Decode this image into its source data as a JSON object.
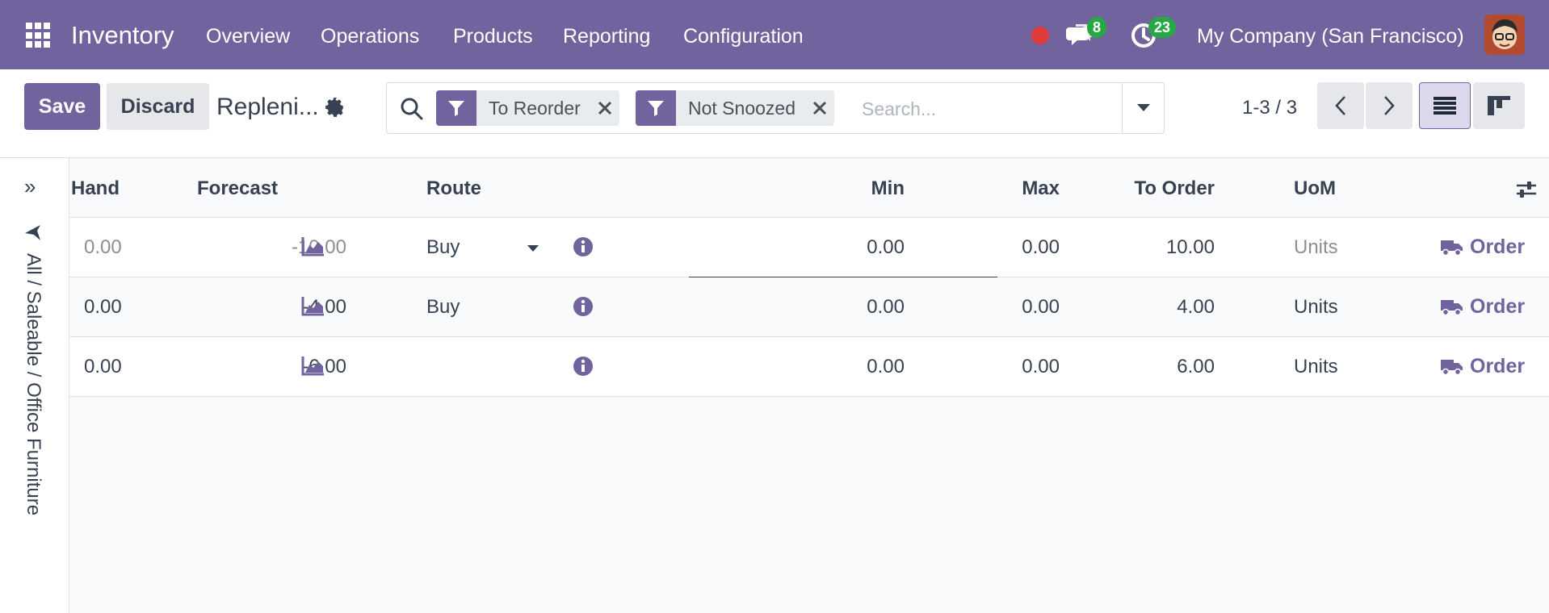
{
  "nav": {
    "brand": "Inventory",
    "menu": [
      "Overview",
      "Operations",
      "Products",
      "Reporting",
      "Configuration"
    ],
    "messages_count": "8",
    "activities_count": "23",
    "company": "My Company (San Francisco)"
  },
  "control": {
    "save_label": "Save",
    "discard_label": "Discard",
    "title": "Repleni...",
    "facets": [
      "To Reorder",
      "Not Snoozed"
    ],
    "search_placeholder": "Search...",
    "pager": "1-3 / 3"
  },
  "side_panel": {
    "expand_glyph": "»",
    "path": "All / Saleable / Office Furniture"
  },
  "table": {
    "headers": {
      "on_hand": "Hand",
      "forecast": "Forecast",
      "route": "Route",
      "min": "Min",
      "max": "Max",
      "to_order": "To Order",
      "uom": "UoM"
    },
    "rows": [
      {
        "on_hand": "0.00",
        "forecast": "-10.00",
        "route": "Buy",
        "min": "0.00",
        "max": "0.00",
        "to_order": "10.00",
        "uom": "Units",
        "action": "Order"
      },
      {
        "on_hand": "0.00",
        "forecast": "-4.00",
        "route": "Buy",
        "min": "0.00",
        "max": "0.00",
        "to_order": "4.00",
        "uom": "Units",
        "action": "Order"
      },
      {
        "on_hand": "0.00",
        "forecast": "-6.00",
        "route": "",
        "min": "0.00",
        "max": "0.00",
        "to_order": "6.00",
        "uom": "Units",
        "action": "Order"
      }
    ]
  },
  "colors": {
    "brand": "#71639e",
    "badge": "#28a745",
    "status_dot": "#e03a3a"
  },
  "icons": [
    "apps-grid-icon",
    "chat-icon",
    "clock-icon",
    "gear-icon",
    "search-icon",
    "filter-icon",
    "close-icon",
    "caret-down-icon",
    "chevron-left-icon",
    "chevron-right-icon",
    "list-view-icon",
    "kanban-view-icon",
    "pin-icon",
    "area-chart-icon",
    "info-icon",
    "truck-icon",
    "column-settings-icon"
  ]
}
